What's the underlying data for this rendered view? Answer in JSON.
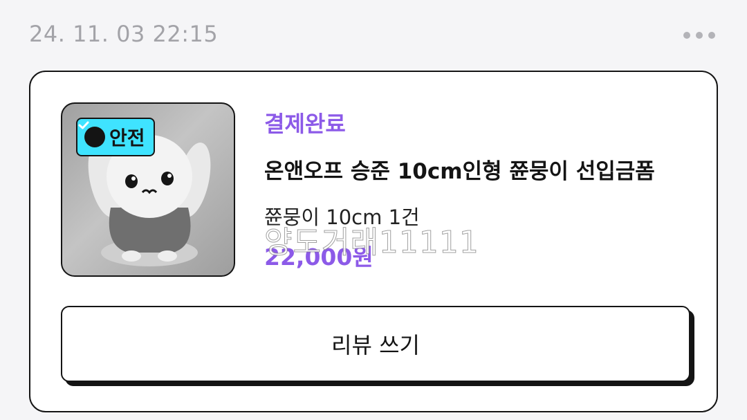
{
  "header": {
    "date": "24. 11. 03 22:15",
    "more_icon": "more-horizontal-icon"
  },
  "order": {
    "badge_label": "안전",
    "badge_icon": "check-circle-icon",
    "status": "결제완료",
    "title": "온앤오프 승준 10cm인형 쮼뭉이 선입금폼",
    "option": "쮼뭉이 10cm 1건",
    "price": "22,000원",
    "watermark": "양도거래11111"
  },
  "actions": {
    "review_label": "리뷰 쓰기"
  },
  "colors": {
    "accent": "#8c5ae8",
    "badge": "#3fe3ff",
    "border": "#141414",
    "date": "#a3a3a8"
  }
}
